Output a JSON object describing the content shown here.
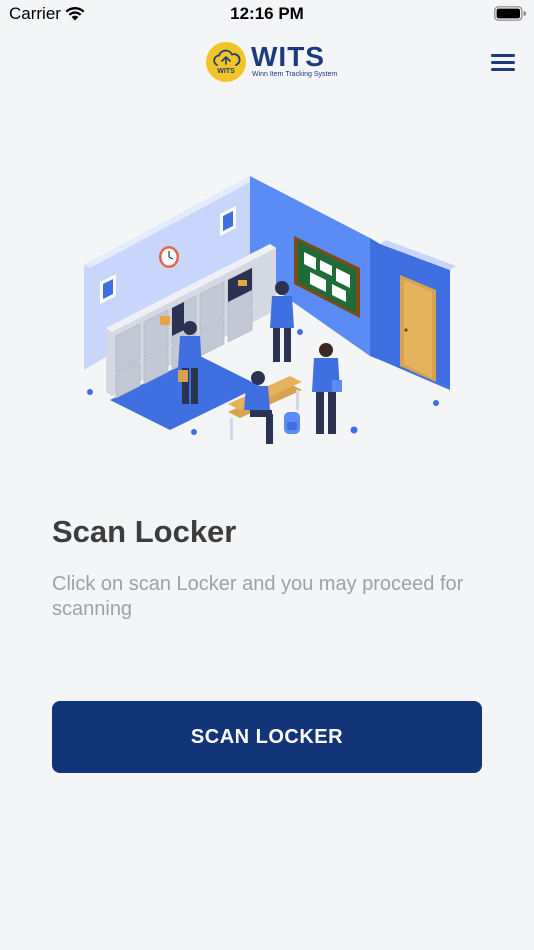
{
  "status_bar": {
    "carrier": "Carrier",
    "time": "12:16 PM",
    "wifi_icon": "wifi-icon",
    "battery_icon": "battery-icon"
  },
  "header": {
    "logo": {
      "mark_text": "WITS",
      "title": "WITS",
      "subtitle": "Winn Item Tracking System"
    },
    "menu_icon": "hamburger-menu-icon"
  },
  "colors": {
    "brand_navy": "#12357a",
    "logo_yellow": "#f2c526",
    "background": "#f4f5f7",
    "title_text": "#3d3d3d",
    "description_text": "#9ea1a6"
  },
  "main": {
    "illustration": "locker-room-illustration",
    "title": "Scan Locker",
    "description": "Click on scan Locker and you may proceed for scanning",
    "scan_button_label": "SCAN LOCKER"
  }
}
